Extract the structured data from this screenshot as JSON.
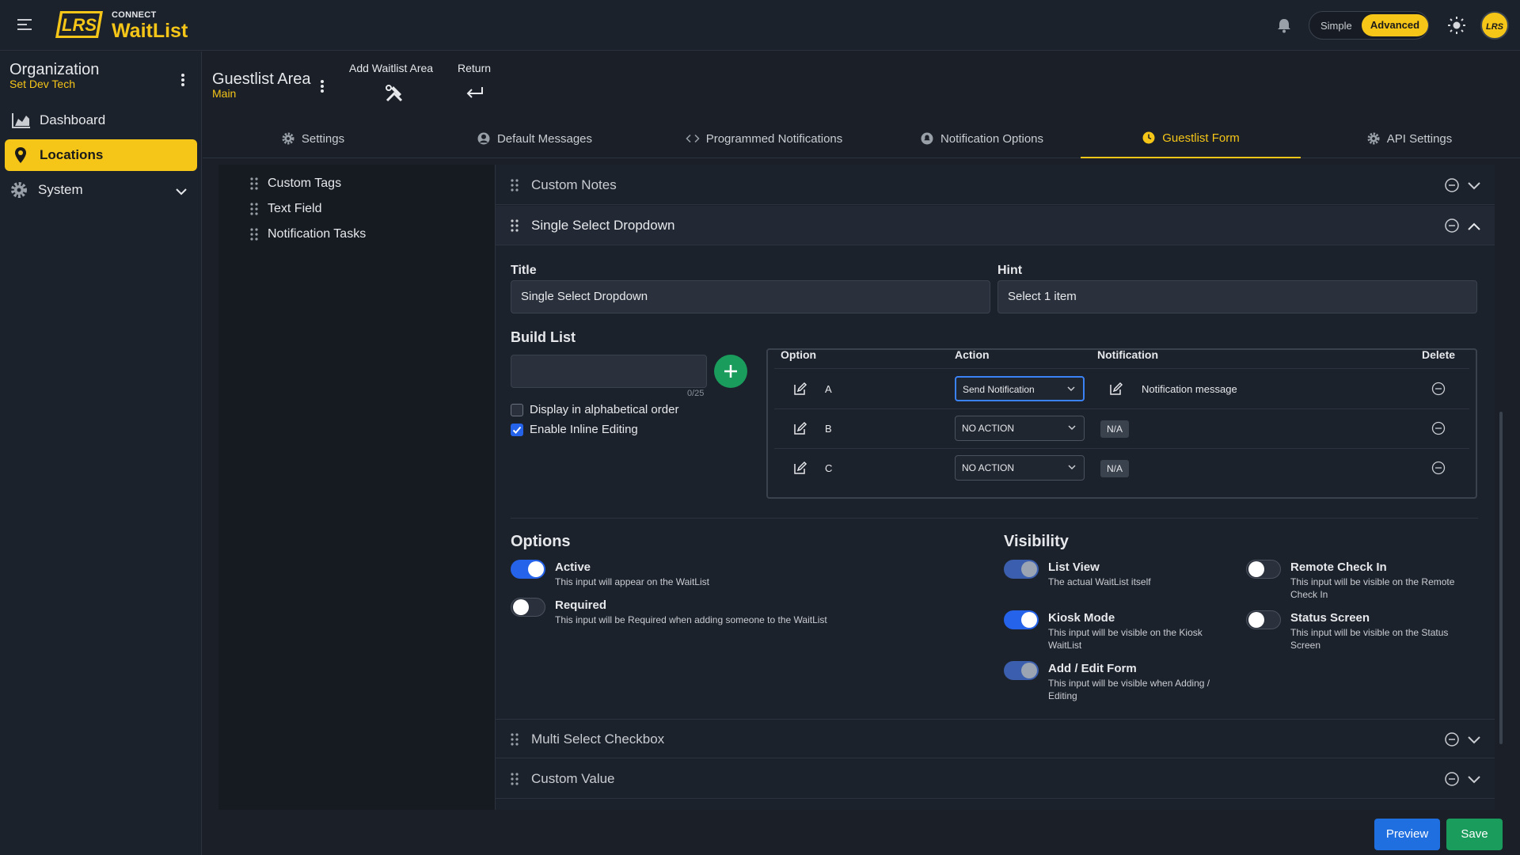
{
  "app": {
    "logo_mark": "LRS",
    "logo_top": "CONNECT",
    "logo_name": "WaitList",
    "mode_simple": "Simple",
    "mode_advanced": "Advanced",
    "avatar_text": "LRS"
  },
  "sidebar": {
    "org_title": "Organization",
    "org_sub": "Set Dev Tech",
    "items": [
      {
        "label": "Dashboard",
        "icon": "chart-icon"
      },
      {
        "label": "Locations",
        "icon": "location-pin-icon",
        "active": true
      },
      {
        "label": "System",
        "icon": "gear-icon"
      }
    ]
  },
  "header": {
    "title": "Guestlist Area",
    "subtitle": "Main",
    "add_label": "Add Waitlist Area",
    "return_label": "Return"
  },
  "tabs": [
    {
      "label": "Settings",
      "icon": "gear-icon"
    },
    {
      "label": "Default Messages",
      "icon": "user-circle-icon"
    },
    {
      "label": "Programmed Notifications",
      "icon": "code-icon"
    },
    {
      "label": "Notification Options",
      "icon": "bell-circle-icon"
    },
    {
      "label": "Guestlist Form",
      "icon": "clock-icon",
      "active": true
    },
    {
      "label": "API Settings",
      "icon": "gear-icon"
    }
  ],
  "left_list": [
    "Custom Tags",
    "Text Field",
    "Notification Tasks"
  ],
  "sections": {
    "custom_notes": "Custom Notes",
    "single_select": "Single Select Dropdown",
    "multi_select": "Multi Select Checkbox",
    "custom_value": "Custom Value"
  },
  "form": {
    "title_label": "Title",
    "title_value": "Single Select Dropdown",
    "hint_label": "Hint",
    "hint_value": "Select 1 item",
    "build_list_label": "Build List",
    "build_input_value": "",
    "counter": "0/25",
    "alpha_label": "Display in alphabetical order",
    "alpha_checked": false,
    "inline_label": "Enable Inline Editing",
    "inline_checked": true
  },
  "table": {
    "headers": {
      "option": "Option",
      "action": "Action",
      "notification": "Notification",
      "delete": "Delete"
    },
    "rows": [
      {
        "option": "A",
        "action": "Send Notification",
        "notification": "Notification message"
      },
      {
        "option": "B",
        "action": "NO ACTION",
        "notification": "N/A"
      },
      {
        "option": "C",
        "action": "NO ACTION",
        "notification": "N/A"
      }
    ]
  },
  "options": {
    "title": "Options",
    "active_title": "Active",
    "active_desc": "This input will appear on the WaitList",
    "active_on": true,
    "required_title": "Required",
    "required_desc": "This input will be Required when adding someone to the WaitList",
    "required_on": false
  },
  "visibility": {
    "title": "Visibility",
    "list_view_title": "List View",
    "list_view_desc": "The actual WaitList itself",
    "kiosk_title": "Kiosk Mode",
    "kiosk_desc_1": "This input will be visible on the Kiosk",
    "kiosk_desc_2": "WaitList",
    "add_edit_title": "Add / Edit Form",
    "add_edit_desc_1": "This input will be visible when Adding /",
    "add_edit_desc_2": "Editing",
    "remote_title": "Remote Check In",
    "remote_desc_1": "This input will be visible on the Remote",
    "remote_desc_2": "Check In",
    "status_title": "Status Screen",
    "status_desc_1": "This input will be visible on the Status",
    "status_desc_2": "Screen"
  },
  "footer": {
    "preview": "Preview",
    "save": "Save"
  },
  "colors": {
    "accent": "#f5c518",
    "primary": "#2563eb",
    "success": "#1a9c5c",
    "bg": "#1a1f28"
  }
}
